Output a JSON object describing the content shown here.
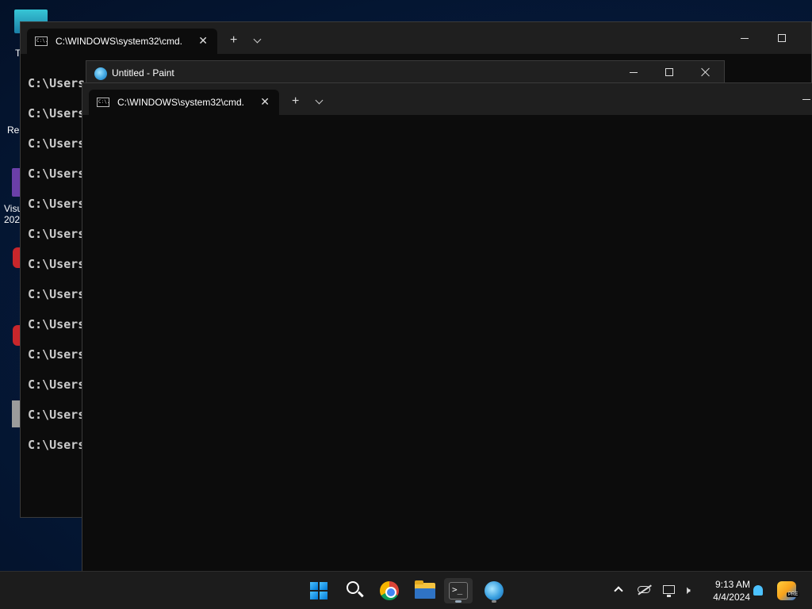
{
  "desktop": {
    "icon_labels": [
      "T",
      "Re",
      "Visu",
      "202"
    ]
  },
  "back_terminal": {
    "tab_title": "C:\\WINDOWS\\system32\\cmd.",
    "tab_icon_text": "C:\\.",
    "new_tab": "+",
    "lines": [
      "C:\\Users",
      "C:\\Users",
      "C:\\Users",
      "C:\\Users",
      "C:\\Users",
      "C:\\Users",
      "C:\\Users",
      "C:\\Users",
      "C:\\Users",
      "C:\\Users",
      "C:\\Users",
      "C:\\Users",
      "C:\\Users"
    ]
  },
  "paint_window": {
    "title": "Untitled - Paint"
  },
  "front_terminal": {
    "tab_title": "C:\\WINDOWS\\system32\\cmd.",
    "tab_icon_text": "C:\\.",
    "new_tab": "+"
  },
  "taskbar": {
    "apps": [
      "start",
      "search",
      "chrome",
      "file-explorer",
      "terminal",
      "paint"
    ],
    "terminal_glyph": ">_",
    "clock": {
      "time": "9:13 AM",
      "date": "4/4/2024"
    },
    "copilot_badge": "PRE"
  }
}
